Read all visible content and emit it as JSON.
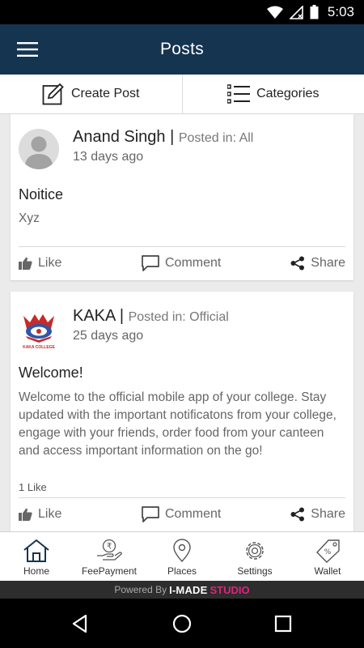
{
  "status_bar": {
    "time": "5:03"
  },
  "app_bar": {
    "title": "Posts"
  },
  "actions": {
    "create_post": "Create Post",
    "categories": "Categories"
  },
  "posts": [
    {
      "author": "Anand Singh",
      "separator": " | ",
      "posted_in": "Posted in: All",
      "date": "13 days ago",
      "title": "Noitice",
      "body": "Xyz",
      "likes": ""
    },
    {
      "author": "KAKA",
      "separator": " | ",
      "posted_in": "Posted in: Official",
      "date": "25 days ago",
      "title": "Welcome!",
      "body": "Welcome to the official mobile app of your college. Stay updated with the important notificatons from your college, engage with your friends, order food from your canteen and access important information on the go!",
      "likes": "1 Like",
      "logo_text": "KAKA COLLEGE"
    }
  ],
  "post_actions": {
    "like": "Like",
    "comment": "Comment",
    "share": "Share"
  },
  "bottom_nav": [
    {
      "label": "Home",
      "icon": "home-icon"
    },
    {
      "label": "FeePayment",
      "icon": "fee-payment-icon"
    },
    {
      "label": "Places",
      "icon": "location-pin-icon"
    },
    {
      "label": "Settings",
      "icon": "gear-icon"
    },
    {
      "label": "Wallet",
      "icon": "tag-icon"
    }
  ],
  "footer": {
    "powered_by": "Powered By",
    "brand": "I-MADE",
    "brand_accent": "STUDIO"
  },
  "colors": {
    "app_bar": "#15344f",
    "brand_accent": "#e0237a"
  }
}
